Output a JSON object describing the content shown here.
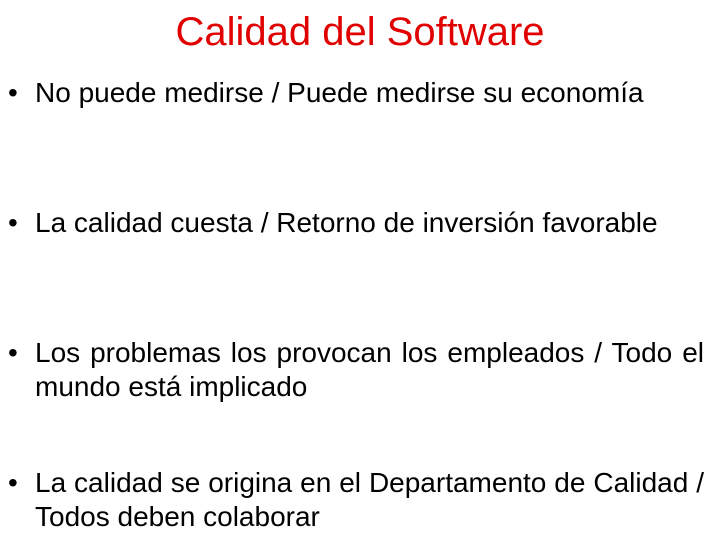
{
  "slide": {
    "title": "Calidad del Software",
    "bullets": [
      {
        "symbol": "•",
        "text": "No puede medirse / Puede medirse su economía"
      },
      {
        "symbol": "•",
        "text": "La calidad cuesta / Retorno de inversión favorable"
      },
      {
        "symbol": "•",
        "text": "Los problemas los provocan los empleados / Todo el mundo está implicado"
      },
      {
        "symbol": "•",
        "text": "La calidad se origina en el Departamento de Calidad / Todos deben colaborar"
      }
    ]
  }
}
